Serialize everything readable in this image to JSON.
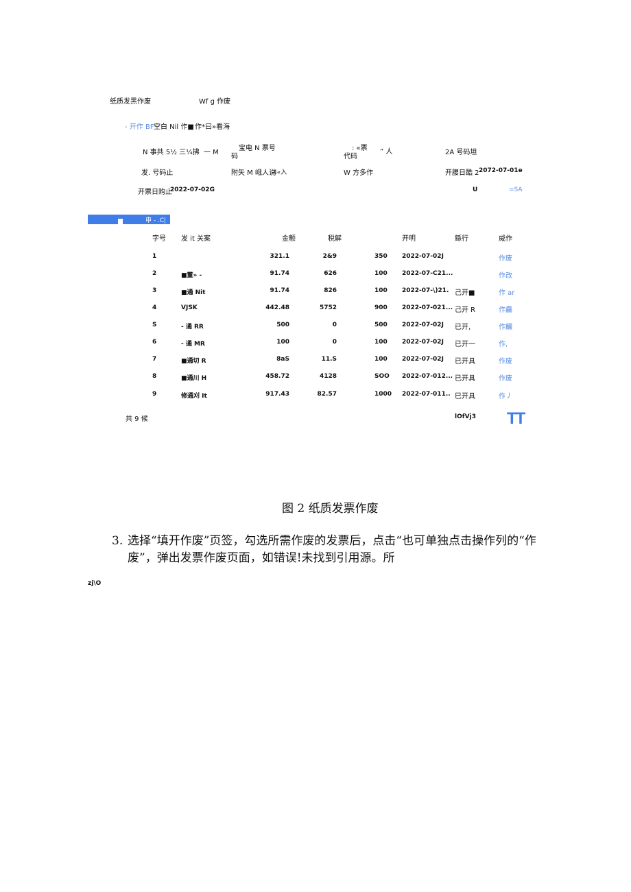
{
  "header": {
    "title": "纸质发黑作废",
    "title_right": "Wf g 作废"
  },
  "tabs": [
    {
      "label": "- 开作 BF",
      "active": true
    },
    {
      "label": "空白 Nil 作■",
      "active": false
    },
    {
      "label": "作*曰»看海",
      "active": false
    }
  ],
  "filters": {
    "row1": {
      "f1": "N 事共 5½ 三¼拂",
      "f1_value": "一 M",
      "f2a": "宝电 N 票号",
      "f2b": "码",
      "f3a": ":  «票",
      "f3b": "代码",
      "f3c": "” 人",
      "f4": "2A 号码坦"
    },
    "row2": {
      "f1": "发. 号码止",
      "f2": "附矢 M 峨人说",
      "f2_value": "4«入",
      "f3": "W 方多作",
      "f4": "开腰日酷 2",
      "f4_value": "2072-07-01e"
    },
    "row3": {
      "f1": "开票日购止",
      "f1_value": "2022-07-02G",
      "btn_u": "U",
      "btn_sa": "=SA"
    }
  },
  "toolbar": {
    "label": "申 - .C|"
  },
  "table": {
    "headers": [
      "字号",
      "发 it 关案",
      "金颤",
      "税解",
      "开明",
      "鲧行",
      "威作"
    ],
    "rows": [
      {
        "no": "1",
        "name": "",
        "amount": "321.1",
        "tax": "2&9",
        "total": "350",
        "date": "2022-07-02J",
        "status": "",
        "op": "作废"
      },
      {
        "no": "2",
        "name": "■董» -",
        "amount": "91.74",
        "tax": "626",
        "total": "100",
        "date": "2022-07-C21...",
        "status": "",
        "op": "作改"
      },
      {
        "no": "3",
        "name": "■通 Nit",
        "amount": "91.74",
        "tax": "826",
        "total": "100",
        "date": "2022-07-\\)21.",
        "status": "己开■",
        "op": "作 ar"
      },
      {
        "no": "4",
        "name": "VJSK",
        "amount": "442.48",
        "tax": "5752",
        "total": "900",
        "date": "2022-07-021...",
        "status": "己开 R",
        "op": "作麤"
      },
      {
        "no": "S",
        "name": "- 通 RR",
        "amount": "500",
        "tax": "0",
        "total": "500",
        "date": "2022-07-02J",
        "status": "已开,",
        "op": "作麣"
      },
      {
        "no": "6",
        "name": "- 通 MR",
        "amount": "100",
        "tax": "0",
        "total": "100",
        "date": "2022-07-02J",
        "status": "已开一",
        "op": "作,"
      },
      {
        "no": "7",
        "name": "■通切 R",
        "amount": "8aS",
        "tax": "11.S",
        "total": "100",
        "date": "2022-07-02J",
        "status": "已开具",
        "op": "作废"
      },
      {
        "no": "8",
        "name": "■通川 H",
        "amount": "458.72",
        "tax": "4128",
        "total": "SOO",
        "date": "2022-07-012...",
        "status": "已开具",
        "op": "作废"
      },
      {
        "no": "9",
        "name": "修通刈 It",
        "amount": "917.43",
        "tax": "82.57",
        "total": "1000",
        "date": "2022-07-011..",
        "status": "巳开具",
        "op": "作丿"
      }
    ]
  },
  "footer": {
    "count": "共 9 候",
    "pager": "lOfVj3",
    "tt": "TT"
  },
  "caption": "图 2 纸质发票作废",
  "paragraph": {
    "number": "3.",
    "line1": "选择“填开作废”页签，勾选所需作废的发票后，点击“也可单独点击操作列的“作",
    "line2": "废”，弹出发票作废页面，如错误!未找到引用源。所"
  },
  "page_tag": "zj\\O",
  "colors": {
    "accent": "#3f7ee8",
    "link": "#5b8ee0"
  }
}
